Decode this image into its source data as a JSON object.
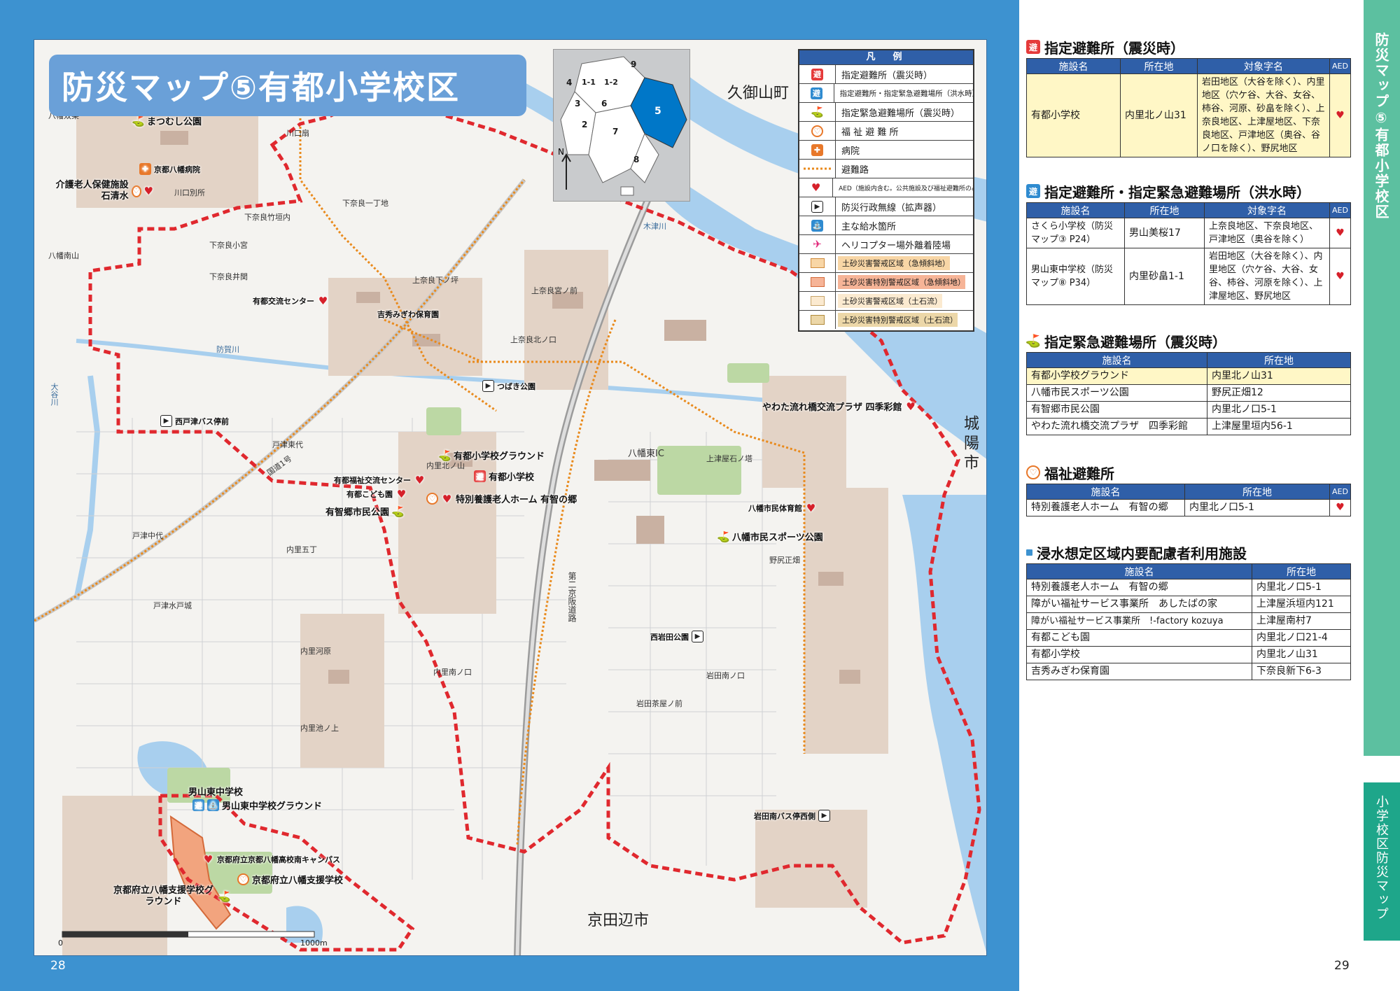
{
  "title": "防災マップ5有都小学校区",
  "title_display": "防災マップ⑤有都小学校区",
  "legend": {
    "heading": "凡　例",
    "items": [
      {
        "label": "指定避難所（震災時）",
        "icon": "shelter-icon"
      },
      {
        "label": "指定避難所・指定緊急避難場所（洪水時）",
        "icon": "flood-shelter-icon"
      },
      {
        "label": "指定緊急避難場所（震災時）",
        "icon": "evacuation-ground-icon"
      },
      {
        "label": "福 祉 避 難 所",
        "icon": "welfare-shelter-icon"
      },
      {
        "label": "病院",
        "icon": "hospital-icon"
      },
      {
        "label": "避難路",
        "icon": "evacuation-route-icon"
      },
      {
        "label": "AED（施設内含む。公共施設及び福祉避難所のみ）",
        "icon": "aed-icon"
      },
      {
        "label": "防災行政無線（拡声器）",
        "icon": "speaker-icon"
      },
      {
        "label": "主な給水箇所",
        "icon": "water-supply-icon"
      },
      {
        "label": "ヘリコプター場外離着陸場",
        "icon": "helipad-icon"
      },
      {
        "label": "土砂災害警戒区域（急傾斜地）",
        "icon": "warning-zone-icon",
        "color": "#f8d6a6"
      },
      {
        "label": "土砂災害特別警戒区域（急傾斜地）",
        "icon": "special-warning-zone-icon",
        "color": "#f6b497"
      },
      {
        "label": "土砂災害警戒区域（土石流）",
        "icon": "debris-zone-icon",
        "color": "#fbead0"
      },
      {
        "label": "土砂災害特別警戒区域（土石流）",
        "icon": "special-debris-zone-icon",
        "color": "#ecd7a8"
      }
    ]
  },
  "inset_map": {
    "labels": [
      "4",
      "1-1",
      "1-2",
      "9",
      "3",
      "6",
      "5",
      "2",
      "7",
      "8"
    ],
    "highlight": "5",
    "highlight_color": "#0077c8"
  },
  "map": {
    "neighbors": [
      "久御山町",
      "城陽市",
      "京田辺市"
    ],
    "river_labels": [
      "木津川",
      "防賀川",
      "大谷川"
    ],
    "road_labels": [
      "第二京阪道路",
      "国道1号",
      "八幡東IC"
    ],
    "places": [
      "川口扇",
      "川口別所",
      "下奈良竹垣内",
      "下奈良一丁地",
      "下奈良小宮",
      "下奈良井関",
      "上奈良下ノ坪",
      "上奈良宮ノ前",
      "上奈良北ノ口",
      "内里北ノ山",
      "内里五丁",
      "内里南ノ口",
      "岩田南ノ口",
      "岩田茶屋ノ前",
      "野尻正畑",
      "上津屋石ノ塔",
      "戸津中代",
      "戸津水戸城",
      "戸津東代",
      "内里河原",
      "内里池ノ上",
      "八幡双栗",
      "八幡南山"
    ],
    "facilities": [
      {
        "label": "まつむし公園",
        "icons": [
          "evacuation-ground-icon"
        ]
      },
      {
        "label": "京都八幡病院",
        "icons": [
          "hospital-icon"
        ]
      },
      {
        "label": "介護老人保健施設石清水",
        "icons": [
          "welfare-shelter-icon",
          "aed-icon"
        ]
      },
      {
        "label": "有都交流センター",
        "icons": [
          "aed-icon"
        ]
      },
      {
        "label": "吉秀みぎわ保育園",
        "icons": []
      },
      {
        "label": "つばき公園",
        "icons": [
          "speaker-icon"
        ]
      },
      {
        "label": "西戸津バス停前",
        "icons": [
          "speaker-icon"
        ]
      },
      {
        "label": "有都小学校グラウンド",
        "icons": [
          "evacuation-ground-icon"
        ]
      },
      {
        "label": "有都小学校",
        "icons": [
          "shelter-icon",
          "water-supply-icon",
          "aed-icon"
        ]
      },
      {
        "label": "有都福祉交流センター",
        "icons": [
          "aed-icon"
        ]
      },
      {
        "label": "有都こども園",
        "icons": [
          "aed-icon"
        ]
      },
      {
        "label": "特別養護老人ホーム 有智の郷",
        "icons": [
          "welfare-shelter-icon",
          "aed-icon"
        ]
      },
      {
        "label": "有智郷市民公園",
        "icons": [
          "evacuation-ground-icon"
        ]
      },
      {
        "label": "やわた流れ橋交流プラザ 四季彩館",
        "icons": [
          "evacuation-ground-icon",
          "aed-icon"
        ]
      },
      {
        "label": "八幡市民体育館",
        "icons": [
          "aed-icon"
        ]
      },
      {
        "label": "八幡市民スポーツ公園",
        "icons": [
          "evacuation-ground-icon",
          "helipad-icon"
        ]
      },
      {
        "label": "西岩田公園",
        "icons": [
          "speaker-icon"
        ]
      },
      {
        "label": "男山東中学校",
        "icons": [
          "flood-shelter-icon",
          "water-supply-icon"
        ]
      },
      {
        "label": "男山東中学校グラウンド",
        "icons": [
          "evacuation-ground-icon"
        ]
      },
      {
        "label": "京都府立京都八幡高校南キャンパス",
        "icons": [
          "aed-icon"
        ]
      },
      {
        "label": "京都府立八幡支援学校",
        "icons": [
          "welfare-shelter-icon"
        ]
      },
      {
        "label": "京都府立八幡支援学校グラウンド",
        "icons": [
          "evacuation-ground-icon"
        ]
      },
      {
        "label": "岩田南バス停西側",
        "icons": [
          "speaker-icon"
        ]
      }
    ],
    "scale": {
      "start": "0",
      "end": "1000m"
    }
  },
  "left_page_number": "28",
  "right_page_number": "29",
  "side_tab_top": "防災マップ⑤有都小学校区",
  "side_tab_bottom": "小学校区防災マップ",
  "sections": {
    "quake_shelter": {
      "title": "指定避難所（震災時）",
      "headers": [
        "施設名",
        "所在地",
        "対象字名",
        "AED"
      ],
      "rows": [
        {
          "name": "有都小学校",
          "address": "内里北ノ山31",
          "areas": "岩田地区（大谷を除く）、内里地区（穴ケ谷、大谷、女谷、柿谷、河原、砂畠を除く）、上奈良地区、上津屋地区、下奈良地区、戸津地区（奥谷、谷ノ口を除く）、野尻地区",
          "aed": "♥"
        }
      ]
    },
    "flood_shelter": {
      "title": "指定避難所・指定緊急避難場所（洪水時）",
      "headers": [
        "施設名",
        "所在地",
        "対象字名",
        "AED"
      ],
      "rows": [
        {
          "name": "さくら小学校（防災マップ③ P24）",
          "address": "男山美桜17",
          "areas": "上奈良地区、下奈良地区、戸津地区（奥谷を除く）",
          "aed": "♥"
        },
        {
          "name": "男山東中学校（防災マップ⑧ P34）",
          "address": "内里砂畠1-1",
          "areas": "岩田地区（大谷を除く）、内里地区（穴ケ谷、大谷、女谷、柿谷、河原を除く）、上津屋地区、野尻地区",
          "aed": "♥"
        }
      ]
    },
    "quake_grounds": {
      "title": "指定緊急避難場所（震災時）",
      "headers": [
        "施設名",
        "所在地"
      ],
      "rows": [
        {
          "name": "有都小学校グラウンド",
          "address": "内里北ノ山31"
        },
        {
          "name": "八幡市民スポーツ公園",
          "address": "野尻正畑12"
        },
        {
          "name": "有智郷市民公園",
          "address": "内里北ノ口5-1"
        },
        {
          "name": "やわた流れ橋交流プラザ　四季彩館",
          "address": "上津屋里垣内56-1"
        }
      ]
    },
    "welfare": {
      "title": "福祉避難所",
      "headers": [
        "施設名",
        "所在地",
        "AED"
      ],
      "rows": [
        {
          "name": "特別養護老人ホーム　有智の郷",
          "address": "内里北ノ口5-1",
          "aed": "♥"
        }
      ]
    },
    "care_facilities": {
      "title": "浸水想定区域内要配慮者利用施設",
      "headers": [
        "施設名",
        "所在地"
      ],
      "rows": [
        {
          "name": "特別養護老人ホーム　有智の郷",
          "address": "内里北ノ口5-1"
        },
        {
          "name": "障がい福祉サービス事業所　あしたばの家",
          "address": "上津屋浜垣内121"
        },
        {
          "name": "障がい福祉サービス事業所　!-factory kozuya",
          "address": "上津屋南村7"
        },
        {
          "name": "有都こども園",
          "address": "内里北ノ口21-4"
        },
        {
          "name": "有都小学校",
          "address": "内里北ノ山31"
        },
        {
          "name": "吉秀みぎわ保育園",
          "address": "下奈良新下6-3"
        }
      ]
    }
  },
  "colors": {
    "page_blue": "#3d92d0",
    "header_blue": "#2f5fa8",
    "tab_green": "#5cc0a0",
    "boundary_red": "#e0282e",
    "river": "#a8cfee",
    "highlight_row": "#fff7c6"
  }
}
